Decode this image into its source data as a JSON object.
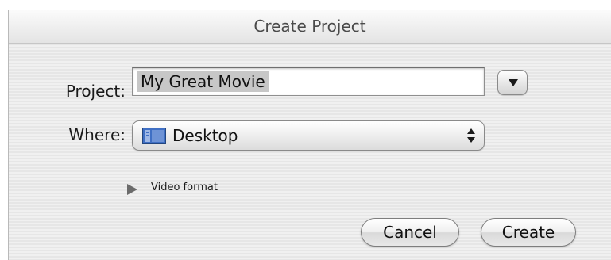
{
  "dialog": {
    "title": "Create Project"
  },
  "project": {
    "label": "Project:",
    "value": "My Great Movie"
  },
  "where": {
    "label": "Where:",
    "selected": "Desktop",
    "icon": "desktop-folder-icon"
  },
  "video_format": {
    "label": "Video format",
    "expanded": false
  },
  "buttons": {
    "cancel": "Cancel",
    "create": "Create"
  }
}
